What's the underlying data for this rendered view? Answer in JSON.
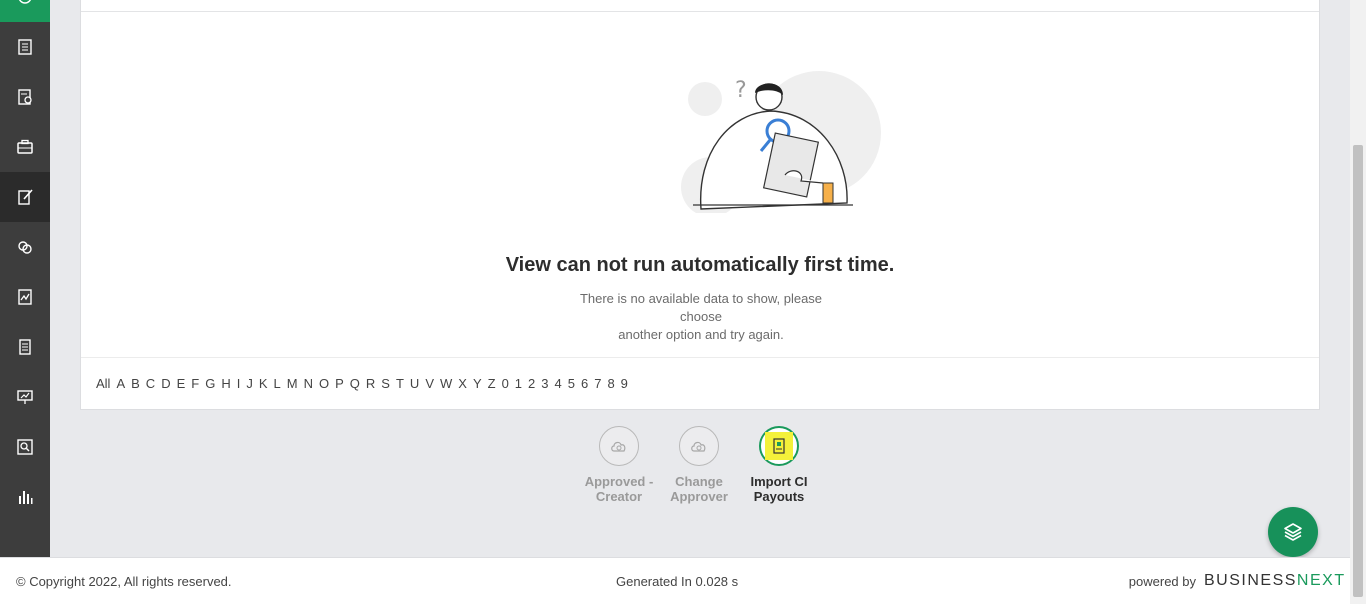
{
  "sidebar": {
    "items": [
      {
        "icon": "clock-icon"
      },
      {
        "icon": "document-list-icon"
      },
      {
        "icon": "document-settings-icon"
      },
      {
        "icon": "briefcase-icon"
      },
      {
        "icon": "edit-document-icon",
        "active": true
      },
      {
        "icon": "exchange-icon"
      },
      {
        "icon": "signed-document-icon"
      },
      {
        "icon": "receipt-icon"
      },
      {
        "icon": "presentation-icon"
      },
      {
        "icon": "search-document-icon"
      },
      {
        "icon": "bar-chart-icon"
      }
    ]
  },
  "empty_state": {
    "title": "View can not run automatically first time.",
    "line1": "There is no available data to show, please choose",
    "line2": "another option and try again."
  },
  "alphabet": [
    "All",
    "A",
    "B",
    "C",
    "D",
    "E",
    "F",
    "G",
    "H",
    "I",
    "J",
    "K",
    "L",
    "M",
    "N",
    "O",
    "P",
    "Q",
    "R",
    "S",
    "T",
    "U",
    "V",
    "W",
    "X",
    "Y",
    "Z",
    "0",
    "1",
    "2",
    "3",
    "4",
    "5",
    "6",
    "7",
    "8",
    "9"
  ],
  "actions": [
    {
      "line1": "Approved -",
      "line2": "Creator",
      "icon": "cloud-icon",
      "enabled": false
    },
    {
      "line1": "Change",
      "line2": "Approver",
      "icon": "cloud-icon",
      "enabled": false
    },
    {
      "line1": "Import CI",
      "line2": "Payouts",
      "icon": "import-document-icon",
      "enabled": true
    }
  ],
  "fab": {
    "icon": "layers-icon"
  },
  "footer": {
    "copyright": "© Copyright 2022, All rights reserved.",
    "generated": "Generated In 0.028 s",
    "powered_by": "powered by",
    "brand_part1": "BUSINESS",
    "brand_part2": "NEXT"
  },
  "colors": {
    "accent": "#1a9a5c",
    "sidebar": "#3d3d3d",
    "highlight": "#f4f13a"
  }
}
